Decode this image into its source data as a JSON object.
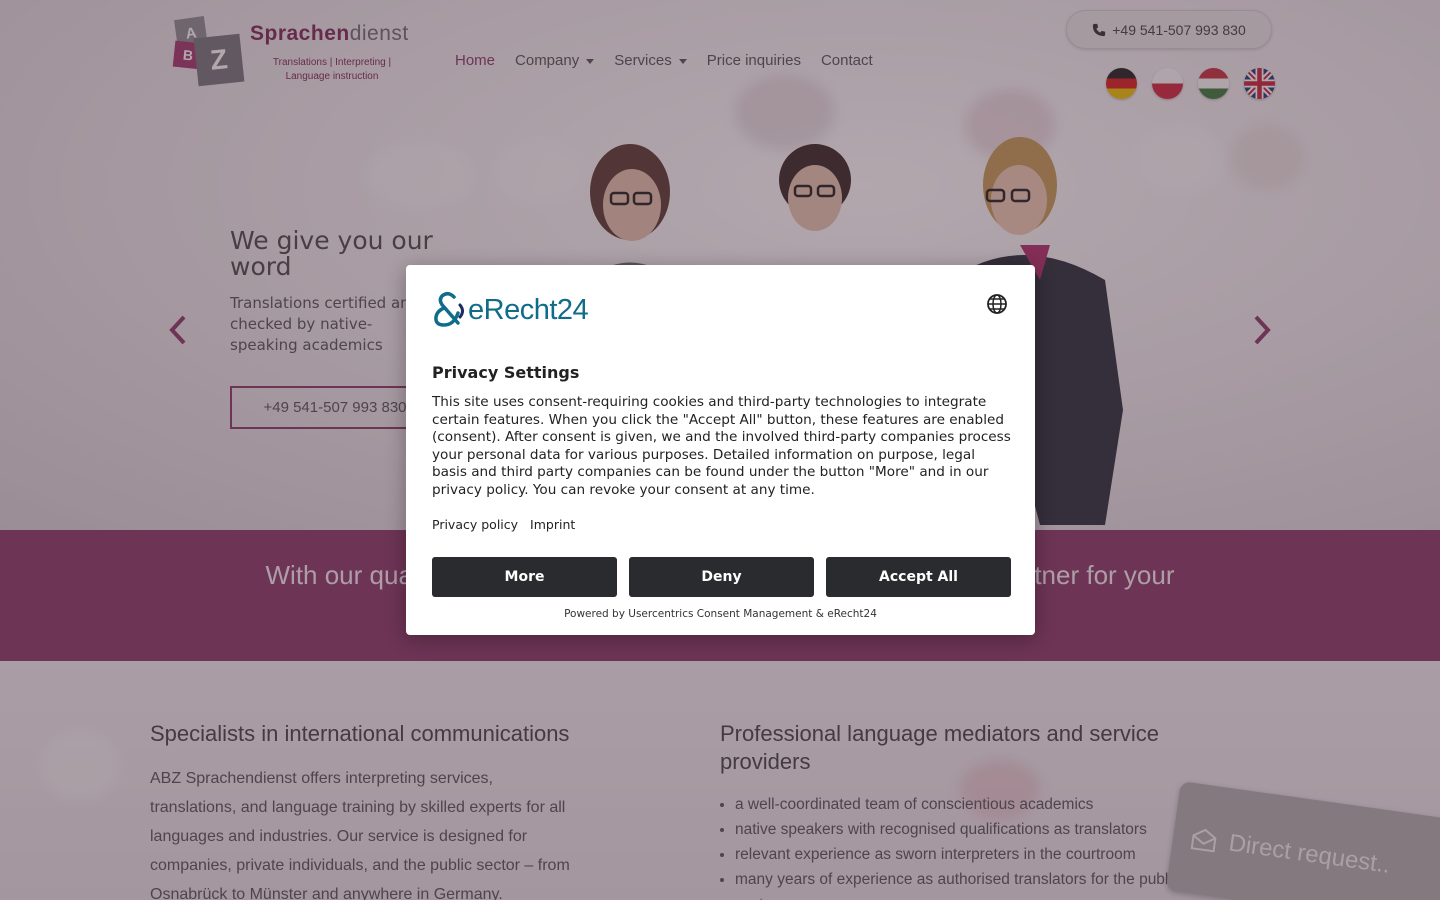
{
  "header": {
    "logo": {
      "name_bold": "Sprachen",
      "name_rest": "dienst",
      "tagline": "Translations | Interpreting | Language instruction",
      "blocks": [
        "A",
        "B",
        "Z"
      ]
    },
    "nav": [
      {
        "label": "Home",
        "has_dropdown": false
      },
      {
        "label": "Company",
        "has_dropdown": true
      },
      {
        "label": "Services",
        "has_dropdown": true
      },
      {
        "label": "Price inquiries",
        "has_dropdown": false
      },
      {
        "label": "Contact",
        "has_dropdown": false
      }
    ],
    "phone": "+49 541-507 993 830",
    "languages": [
      "german-flag",
      "polish-flag",
      "hungarian-flag",
      "english-flag"
    ]
  },
  "hero": {
    "title": "We give you our word",
    "text": "Translations certified and checked by native-speaking academics",
    "button": "+49 541-507 993 830"
  },
  "band": {
    "text": "With our qualified interpreters and translators, we are a reliable partner for your"
  },
  "content": {
    "left_title": "Specialists in international communications",
    "left_text": "ABZ Sprachendienst offers interpreting services, translations, and language training by skilled experts for all languages and industries. Our service is designed for companies, private individuals, and the public sector – from Osnabrück to Münster and anywhere in Germany.",
    "right_title": "Professional language mediators and service providers",
    "right_list": [
      "a well-coordinated team of conscientious academics",
      "native speakers with recognised qualifications as translators",
      "relevant experience as sworn interpreters in the courtroom",
      "many years of experience as authorised translators for the public sector"
    ],
    "direct_request": "Direct request.."
  },
  "consent": {
    "brand": "eRecht24",
    "title": "Privacy Settings",
    "body": "This site uses consent-requiring cookies and third-party technologies to integrate certain features. When you click the \"Accept All\" button, these features are enabled (consent). After consent is given, we and the involved third-party companies process your personal data for various purposes. Detailed information on purpose, legal basis and third party companies can be found under the button \"More\" and in our privacy policy. You can revoke your consent at any time.",
    "links": {
      "privacy": "Privacy policy",
      "imprint": "Imprint"
    },
    "buttons": {
      "more": "More",
      "deny": "Deny",
      "accept": "Accept All"
    },
    "powered": "Powered by Usercentrics Consent Management & eRecht24"
  },
  "colors": {
    "brand": "#8a3a68",
    "button_dark": "#2a2b2e",
    "erecht_blue": "#0f6c8a"
  }
}
